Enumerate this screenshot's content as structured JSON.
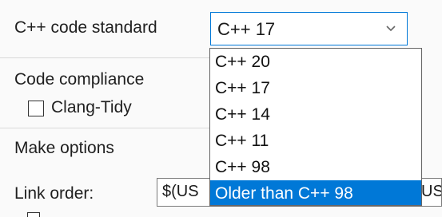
{
  "settings": {
    "standard_label": "C++ code standard",
    "selected_standard": "C++ 17",
    "compliance_label": "Code compliance",
    "clang_tidy_label": "Clang-Tidy",
    "make_options_label": "Make options",
    "link_order_label": "Link order:",
    "link_order_prefix": "$(US",
    "link_order_suffix": "US_L"
  },
  "dropdown": {
    "options": [
      "C++ 20",
      "C++ 17",
      "C++ 14",
      "C++ 11",
      "C++ 98",
      "Older than C++ 98"
    ],
    "highlighted_option": "Older than C++ 98"
  },
  "colors": {
    "accent": "#0078d7",
    "selection": "#0078d7"
  },
  "icons": {
    "combo_arrow": "chevron-down-icon",
    "checkbox": "checkbox-icon"
  }
}
